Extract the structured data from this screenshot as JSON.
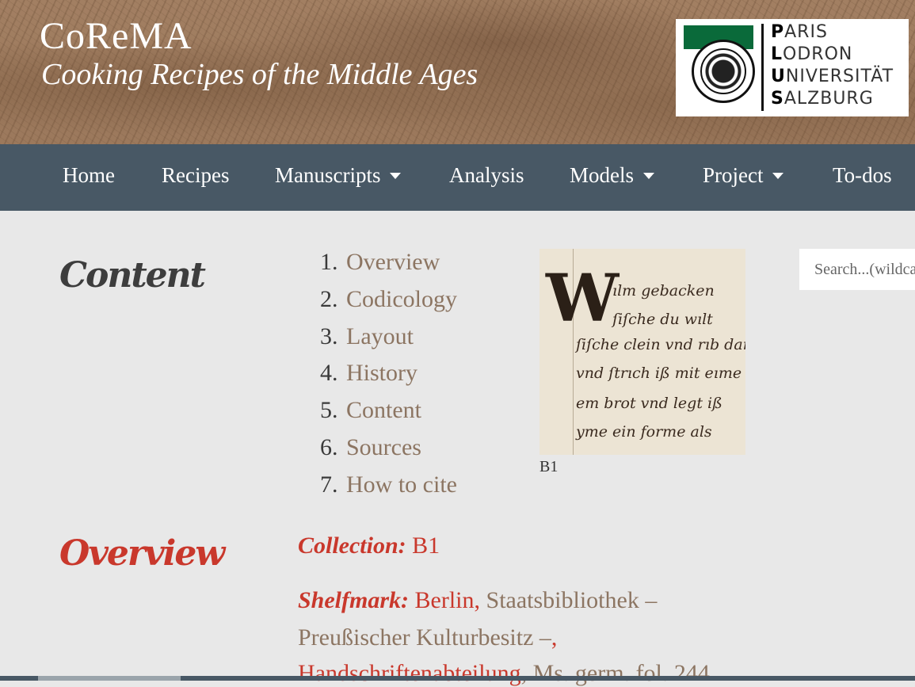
{
  "banner": {
    "title": "CoReMA",
    "subtitle": "Cooking Recipes of the Middle Ages"
  },
  "logo": {
    "line1_initial": "P",
    "line1_rest": "ARIS",
    "line2_initial": "L",
    "line2_rest": "ODRON",
    "line3_initial": "U",
    "line3_rest": "NIVERSITÄT",
    "line4_initial": "S",
    "line4_rest": "ALZBURG",
    "colors": {
      "green": "#0a6a3a"
    }
  },
  "nav": {
    "items": [
      {
        "label": "Home",
        "dropdown": false
      },
      {
        "label": "Recipes",
        "dropdown": false
      },
      {
        "label": "Manuscripts",
        "dropdown": true
      },
      {
        "label": "Analysis",
        "dropdown": false
      },
      {
        "label": "Models",
        "dropdown": true
      },
      {
        "label": "Project",
        "dropdown": true
      },
      {
        "label": "To-dos",
        "dropdown": false
      }
    ]
  },
  "content": {
    "heading": "Content",
    "toc": [
      {
        "num": "1.",
        "label": "Overview"
      },
      {
        "num": "2.",
        "label": "Codicology"
      },
      {
        "num": "3.",
        "label": "Layout"
      },
      {
        "num": "4.",
        "label": "History"
      },
      {
        "num": "5.",
        "label": "Content"
      },
      {
        "num": "6.",
        "label": "Sources"
      },
      {
        "num": "7.",
        "label": "How to cite"
      }
    ],
    "image_caption": "B1",
    "search_placeholder": "Search...(wildcard: *)"
  },
  "overview": {
    "heading": "Overview",
    "collection_label": "Collection:",
    "collection_value": "B1",
    "shelfmark_label": "Shelfmark:",
    "shelfmark_city": "Berlin",
    "shelfmark_comma1": ",",
    "shelfmark_library": "Staatsbibliothek –",
    "shelfmark_library2": "Preußischer Kulturbesitz –",
    "shelfmark_comma2": ",",
    "shelfmark_dept": "Handschriftenabteilung",
    "shelfmark_sig": ", Ms. germ. fol. 244"
  },
  "colors": {
    "navbar": "#485865",
    "accent_red": "#c9382c",
    "link_brown": "#8c7562",
    "background": "#e8e8e8"
  }
}
